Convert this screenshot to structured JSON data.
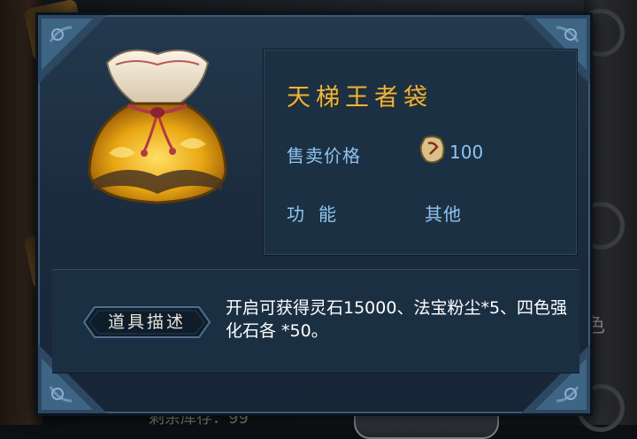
{
  "background": {
    "right_text": "色",
    "bottom_text": "剩余库存：99"
  },
  "dialog": {
    "item_name": "天梯王者袋",
    "price_label": "售卖价格",
    "price_value": "100",
    "price_icon": "spirit-stone-icon",
    "function_label": "功能",
    "function_value": "其他",
    "item_icon": "treasure-pouch-icon",
    "description_label": "道具描述",
    "description_text": "开启可获得灵石15000、法宝粉尘*5、四色强化石各 *50。"
  },
  "colors": {
    "dialog_bg": "#1b2c3f",
    "name_gold": "#e2b44a",
    "label_blue": "#8fc3f0",
    "desc_white": "#ffffff"
  }
}
